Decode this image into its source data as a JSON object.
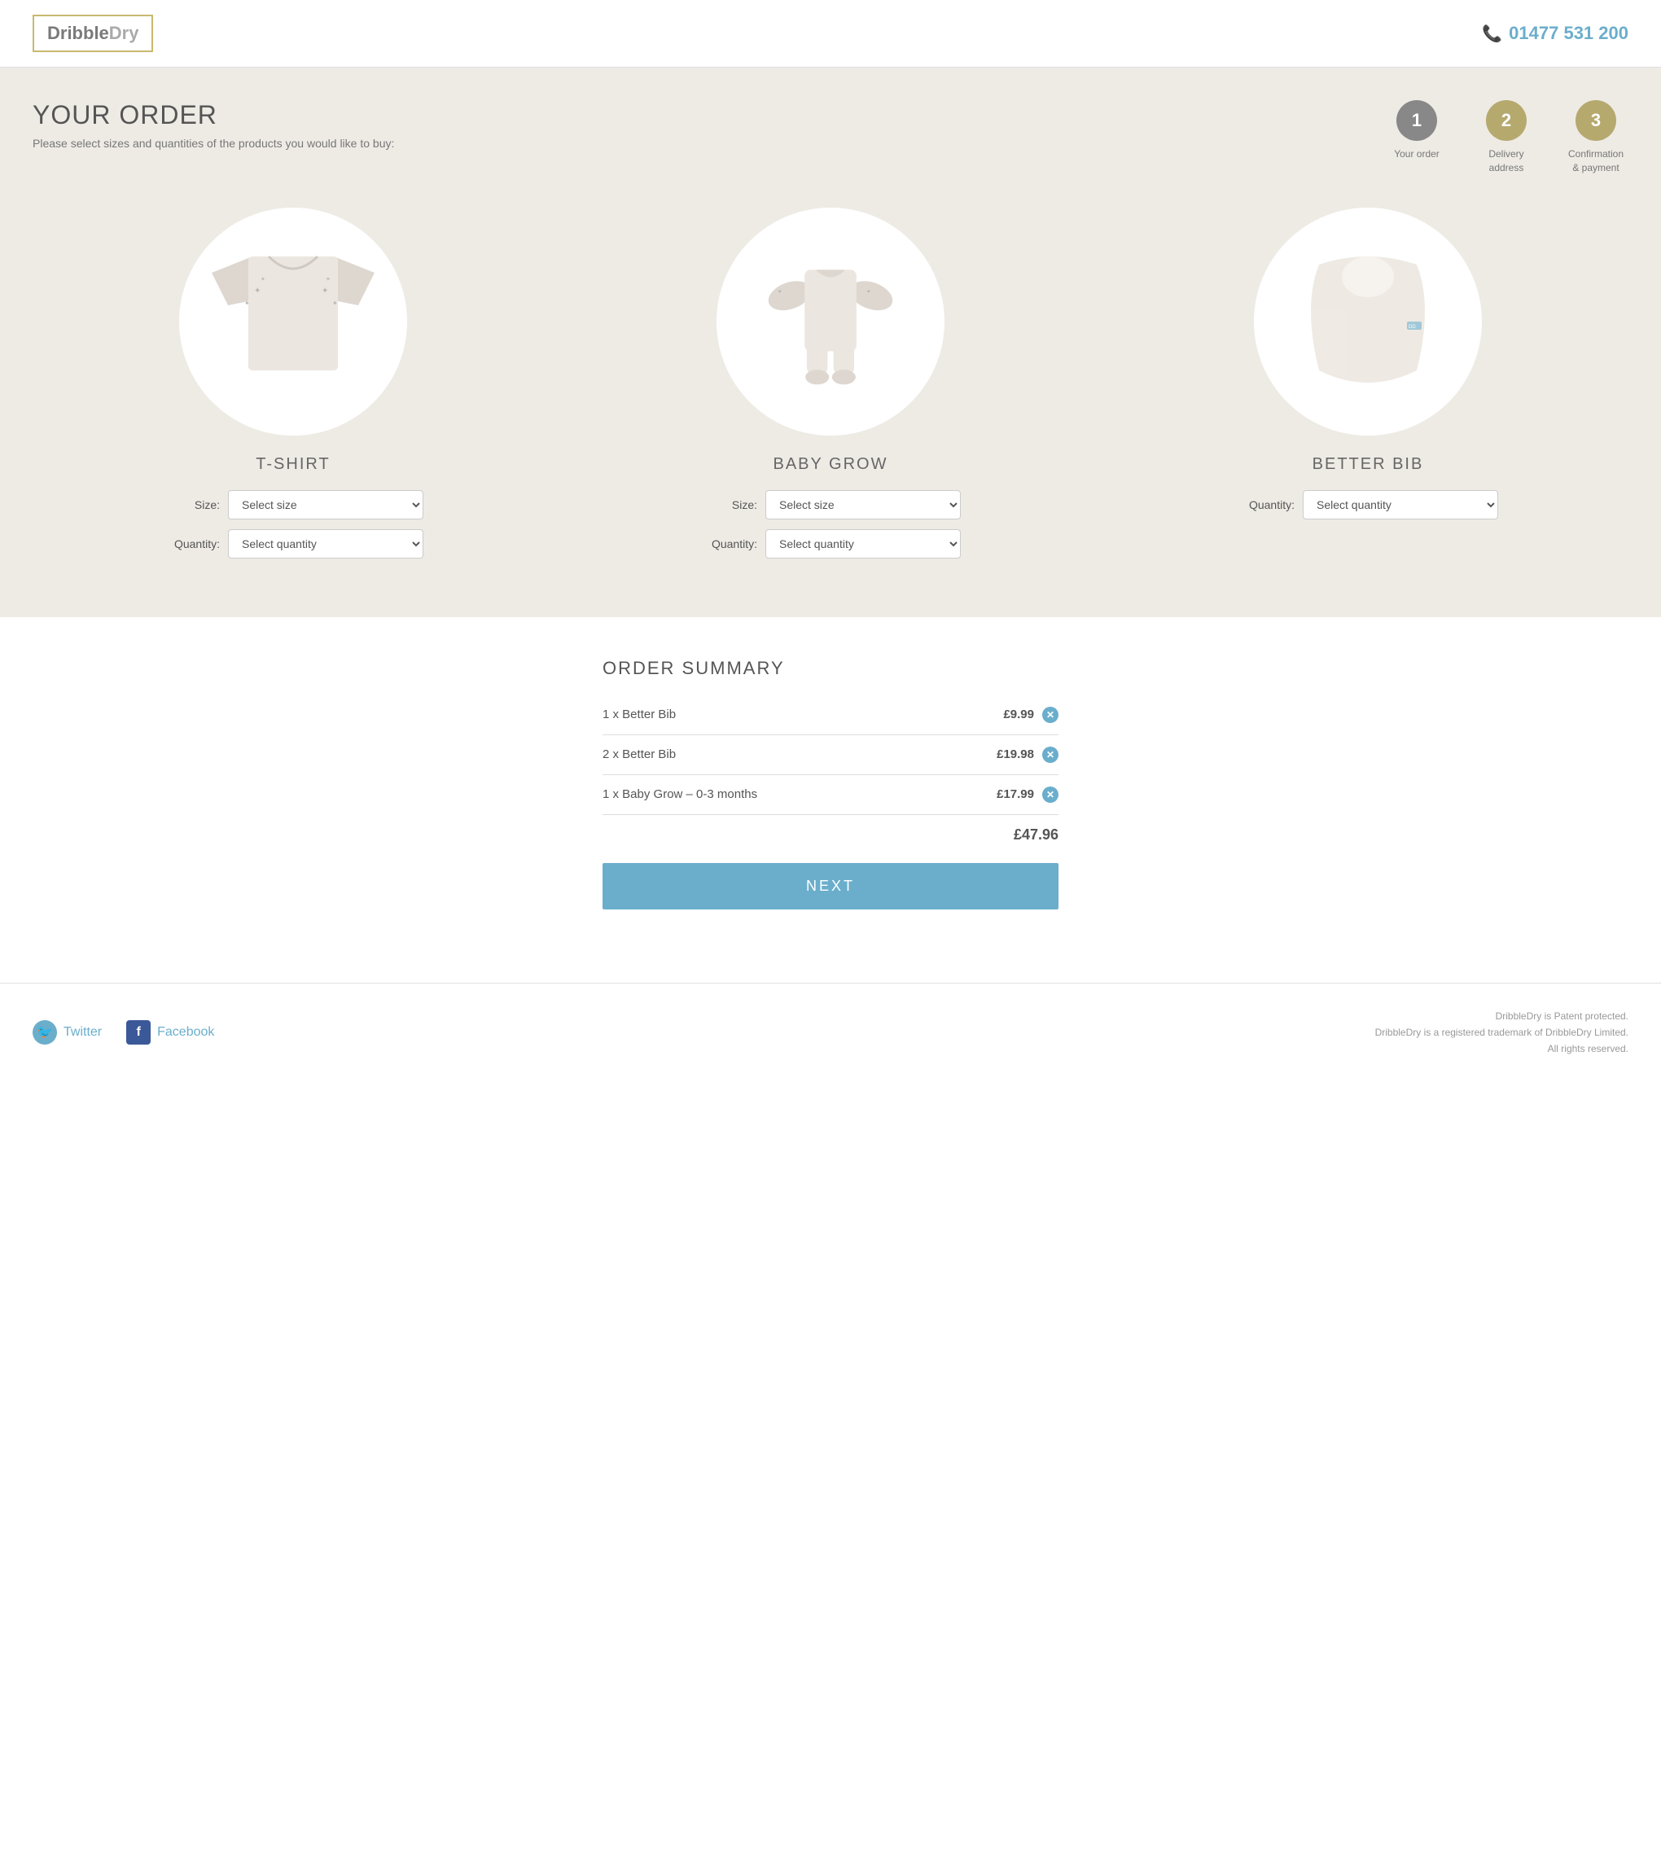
{
  "header": {
    "logo_dribble": "Dribble",
    "logo_dry": "Dry",
    "phone_number": "01477 531 200"
  },
  "steps": [
    {
      "number": "1",
      "label": "Your order",
      "state": "active"
    },
    {
      "number": "2",
      "label": "Delivery\naddress",
      "state": "inactive"
    },
    {
      "number": "3",
      "label": "Confirmation\n& payment",
      "state": "inactive"
    }
  ],
  "order": {
    "title": "YOUR ORDER",
    "subtitle": "Please select sizes and quantities of the products you would like to buy:"
  },
  "products": [
    {
      "name": "T-SHIRT",
      "has_size": true,
      "has_quantity": true,
      "size_placeholder": "Select size",
      "quantity_placeholder": "Select quantity",
      "type": "tshirt"
    },
    {
      "name": "BABY GROW",
      "has_size": true,
      "has_quantity": true,
      "size_placeholder": "Select size",
      "quantity_placeholder": "Select quantity",
      "type": "babygrow"
    },
    {
      "name": "BETTER BIB",
      "has_size": false,
      "has_quantity": true,
      "quantity_placeholder": "Select quantity",
      "type": "bib"
    }
  ],
  "labels": {
    "size": "Size:",
    "quantity": "Quantity:"
  },
  "summary": {
    "title": "ORDER SUMMARY",
    "items": [
      {
        "description": "1 x Better Bib",
        "price": "£9.99"
      },
      {
        "description": "2 x Better Bib",
        "price": "£19.98"
      },
      {
        "description": "1 x Baby Grow – 0-3 months",
        "price": "£17.99"
      }
    ],
    "total": "£47.96",
    "next_button": "NEXT"
  },
  "footer": {
    "twitter_label": "Twitter",
    "facebook_label": "Facebook",
    "legal_line1": "DribbleDry is Patent protected.",
    "legal_line2": "DribbleDry is a registered trademark of DribbleDry Limited.",
    "legal_line3": "All rights reserved."
  }
}
